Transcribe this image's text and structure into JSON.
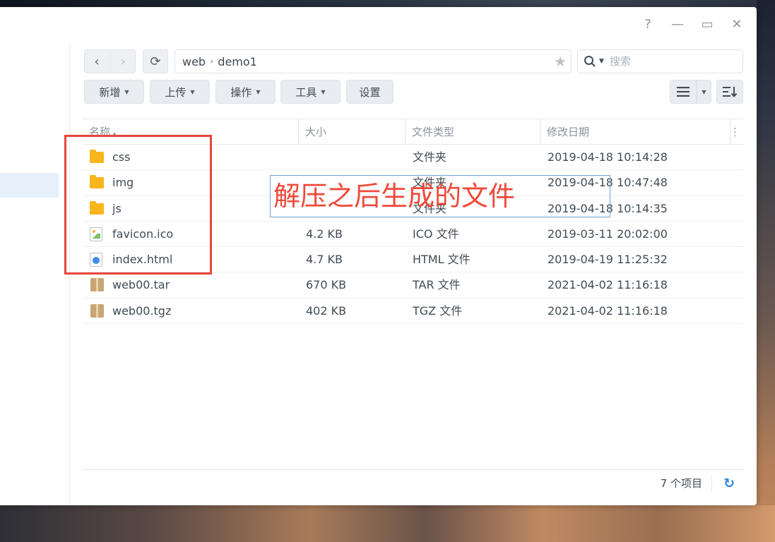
{
  "window": {
    "controls": {
      "help": "?",
      "minimize": "—",
      "maximize": "▭",
      "close": "✕"
    }
  },
  "toolbar": {
    "back": "‹",
    "forward": "›",
    "refresh": "⟳",
    "path": [
      "web",
      "demo1"
    ],
    "search_placeholder": "搜索",
    "buttons": {
      "new": "新增",
      "upload": "上传",
      "action": "操作",
      "tools": "工具",
      "settings": "设置"
    }
  },
  "table": {
    "columns": {
      "name": "名称",
      "size": "大小",
      "type": "文件类型",
      "modified": "修改日期"
    },
    "rows": [
      {
        "name": "css",
        "size": "",
        "type": "文件夹",
        "modified": "2019-04-18 10:14:28",
        "icon": "folder-icon"
      },
      {
        "name": "img",
        "size": "",
        "type": "文件夹",
        "modified": "2019-04-18 10:47:48",
        "icon": "folder-icon"
      },
      {
        "name": "js",
        "size": "",
        "type": "文件夹",
        "modified": "2019-04-18 10:14:35",
        "icon": "folder-icon"
      },
      {
        "name": "favicon.ico",
        "size": "4.2 KB",
        "type": "ICO 文件",
        "modified": "2019-03-11 20:02:00",
        "icon": "image-file-icon"
      },
      {
        "name": "index.html",
        "size": "4.7 KB",
        "type": "HTML 文件",
        "modified": "2019-04-19 11:25:32",
        "icon": "html-file-icon"
      },
      {
        "name": "web00.tar",
        "size": "670 KB",
        "type": "TAR 文件",
        "modified": "2021-04-02 11:16:18",
        "icon": "archive-icon"
      },
      {
        "name": "web00.tgz",
        "size": "402 KB",
        "type": "TGZ 文件",
        "modified": "2021-04-02 11:16:18",
        "icon": "archive-icon"
      }
    ]
  },
  "annotation": {
    "text": "解压之后生成的文件",
    "color": "#ee4a3a",
    "box_color": "#e8453c"
  },
  "footer": {
    "count": "7 个项目"
  },
  "colors": {
    "accent": "#2f86e0",
    "folder": "#f9b51c"
  }
}
